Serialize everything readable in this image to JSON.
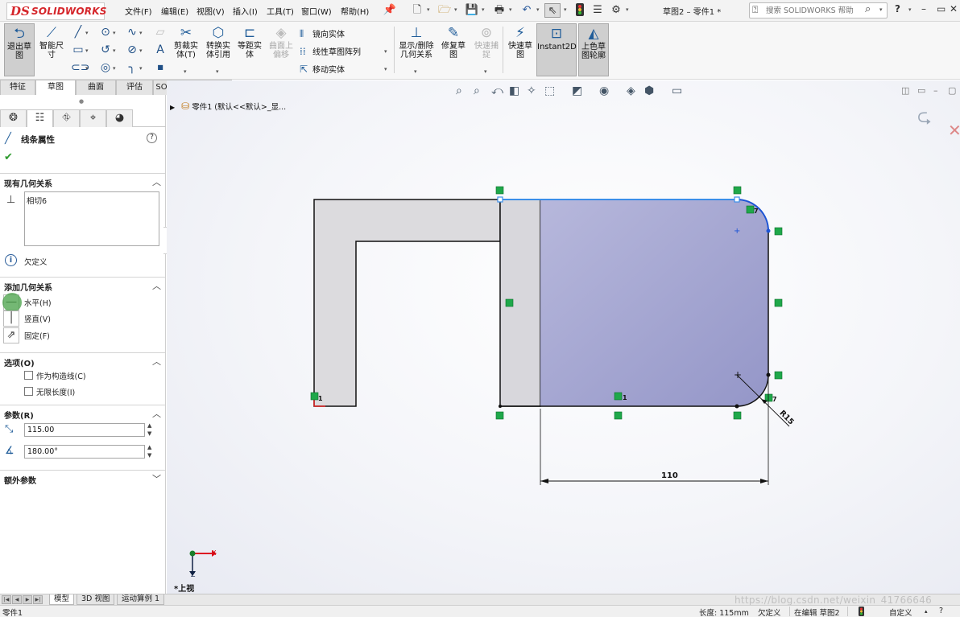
{
  "app": {
    "logo_prefix": "DS",
    "logo_text": "SOLIDWORKS",
    "doc_title": "草图2 – 零件1 *",
    "menu": [
      "文件(F)",
      "编辑(E)",
      "视图(V)",
      "插入(I)",
      "工具(T)",
      "窗口(W)",
      "帮助(H)"
    ],
    "help_search_placeholder": "搜索 SOLIDWORKS 帮助"
  },
  "toolbar": {
    "exit_sketch": "退出草图",
    "smart_dim": "智能尺寸",
    "trim": "剪裁实体(T)",
    "convert": "转换实体引用",
    "offset": "等距实体",
    "surface_offset": "曲面上偏移",
    "mirror": "镜向实体",
    "linear_pattern": "线性草图阵列",
    "move": "移动实体",
    "show_relations": "显示/删除几何关系",
    "repair": "修复草图",
    "quick_snap": "快速捕捉",
    "rapid_sketch": "快速草图",
    "instant2d": "Instant2D",
    "shaded_contours": "上色草图轮廓"
  },
  "tabs": [
    "特征",
    "草图",
    "曲面",
    "评估",
    "SOLIDWORKS 插件"
  ],
  "active_tab": "草图",
  "pm": {
    "title": "线条属性",
    "existing_rel_header": "现有几何关系",
    "existing_relations": [
      "相切6"
    ],
    "status": "欠定义",
    "add_rel_header": "添加几何关系",
    "add_relations": [
      "水平(H)",
      "竖直(V)",
      "固定(F)"
    ],
    "options_header": "选项(O)",
    "options": [
      "作为构造线(C)",
      "无限长度(I)"
    ],
    "params_header": "参数(R)",
    "length_value": "115.00",
    "angle_value": "180.00°",
    "extra_header": "额外参数"
  },
  "tree": {
    "flyout": "零件1 (默认<<默认>_显..."
  },
  "sketch": {
    "dim_horizontal": "110",
    "dim_radius": "R15",
    "rel_badge": "1",
    "rel_badge_7": "7"
  },
  "view": {
    "name": "*上视",
    "axis_x": "X",
    "axis_z": "Z"
  },
  "bottom_tabs": [
    "模型",
    "3D 视图",
    "运动算例 1"
  ],
  "status": {
    "left": "零件1",
    "length": "长度: 115mm",
    "define": "欠定义",
    "editing": "在编辑 草图2",
    "custom": "自定义"
  },
  "watermark": "https://blog.csdn.net/weixin_41766646",
  "colors": {
    "brand_red": "#d5262b",
    "sketch_fill": "#9a9ccc",
    "selected_line": "#3b8ee8",
    "relation_green": "#1fa84a"
  }
}
